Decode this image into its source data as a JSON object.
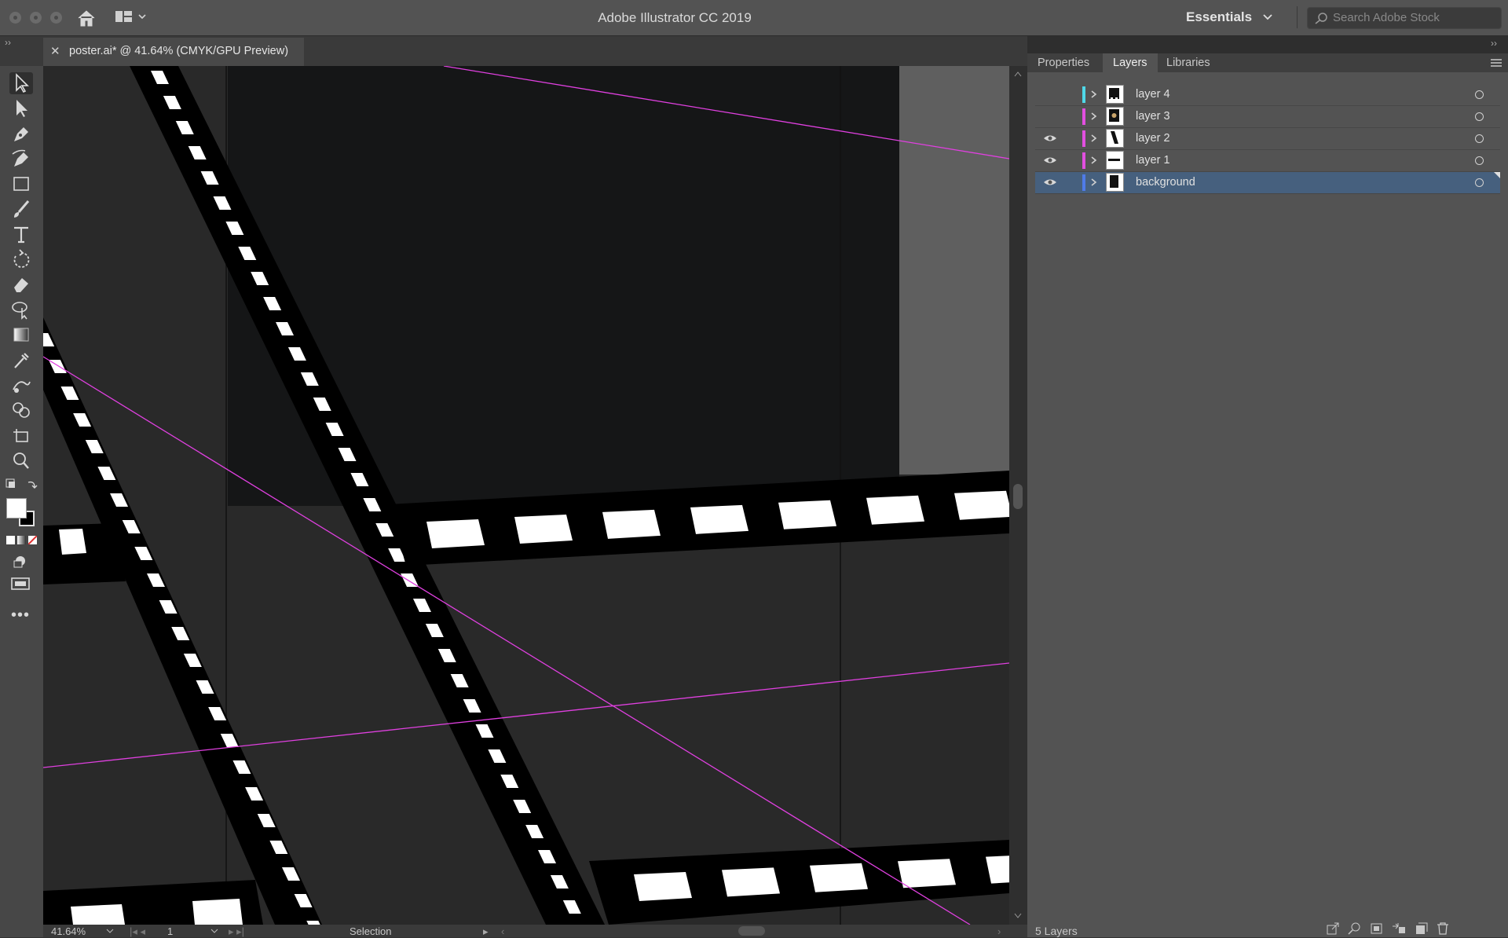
{
  "app": {
    "title": "Adobe Illustrator CC 2019",
    "workspace_label": "Essentials",
    "stock_search_placeholder": "Search Adobe Stock"
  },
  "document": {
    "tab_label": "poster.ai* @ 41.64% (CMYK/GPU Preview)",
    "close_glyph": "✕"
  },
  "tools": [
    "selection-tool-icon",
    "direct-selection-tool-icon",
    "pen-tool-icon",
    "curvature-tool-icon",
    "rectangle-tool-icon",
    "paintbrush-tool-icon",
    "type-tool-icon",
    "rotate-tool-icon",
    "eraser-tool-icon",
    "puppet-warp-tool-icon",
    "gradient-tool-icon",
    "eyedropper-tool-icon",
    "blend-tool-icon",
    "shape-builder-tool-icon",
    "artboard-tool-icon",
    "zoom-tool-icon"
  ],
  "panel": {
    "tabs": [
      "Properties",
      "Layers",
      "Libraries"
    ],
    "active_tab": "Layers",
    "layers": [
      {
        "name": "layer 4",
        "visible": false,
        "color": "#4fd8e8",
        "selected": false
      },
      {
        "name": "layer 3",
        "visible": false,
        "color": "#e24fe0",
        "selected": false
      },
      {
        "name": "layer 2",
        "visible": true,
        "color": "#e24fe0",
        "selected": false
      },
      {
        "name": "layer 1",
        "visible": true,
        "color": "#e24fe0",
        "selected": false
      },
      {
        "name": "background",
        "visible": true,
        "color": "#4f7be8",
        "selected": true
      }
    ],
    "footer_count": "5 Layers"
  },
  "status": {
    "zoom": "41.64%",
    "artboard": "1",
    "tool_name": "Selection"
  },
  "colors": {
    "guide": "#e040e0",
    "selection": "#46607e"
  }
}
